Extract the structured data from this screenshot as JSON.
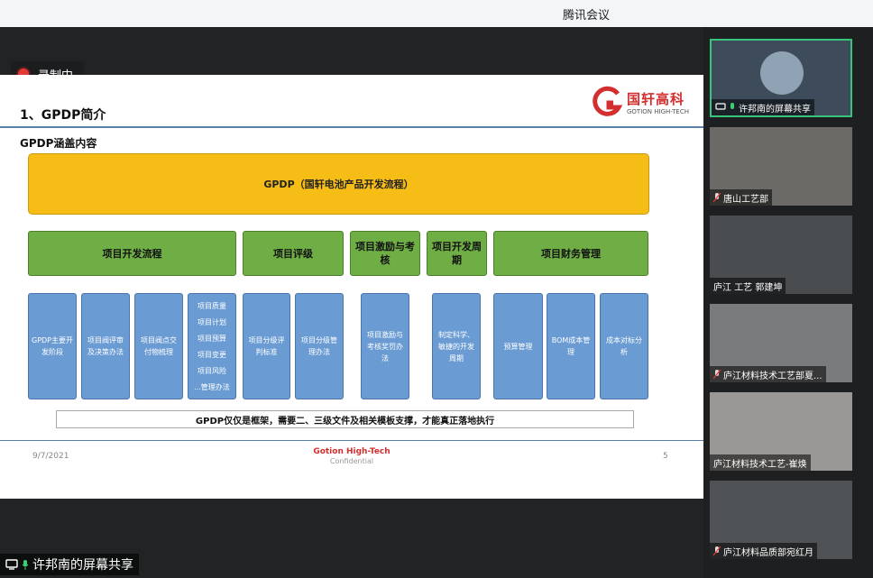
{
  "window": {
    "title": "腾讯会议"
  },
  "recording": {
    "label": "录制中"
  },
  "slide": {
    "logo_cn": "国轩高科",
    "logo_en": "GOTION HIGH-TECH",
    "heading": "1、GPDP简介",
    "subheading": "GPDP涵盖内容",
    "top_box": "GPDP（国轩电池产品开发流程）",
    "categories": [
      "项目开发流程",
      "项目评级",
      "项目激励与考核",
      "项目开发周期",
      "项目财务管理"
    ],
    "items": [
      "GPDP主要开发阶段",
      "项目阀评审及决策办法",
      "项目阀点交付物梳理",
      "项目分级评判标准",
      "项目分级管理办法",
      "项目激励与考核奖罚办法",
      "制定科学、敏捷的开发周期",
      "预算管理",
      "BOM成本管理",
      "成本对标分析"
    ],
    "list_item": [
      "项目质量",
      "项目计划",
      "项目预算",
      "项目变更",
      "项目风险",
      "...管理办法"
    ],
    "footer_note": "GPDP仅仅是框架，需要二、三级文件及相关模板支撑，才能真正落地执行",
    "date": "9/7/2021",
    "company": "Gotion High-Tech",
    "confidential": "Confidential",
    "page_number": "5"
  },
  "share_bar": {
    "label": "许邦南的屏幕共享"
  },
  "participants": [
    {
      "name": "许邦南的屏幕共享",
      "active": true
    },
    {
      "name": "唐山工艺部"
    },
    {
      "name": "庐江 工艺 郭建坤"
    },
    {
      "name": "庐江材料技术工艺部夏..."
    },
    {
      "name": "庐江材料技术工艺-崔焕"
    },
    {
      "name": "庐江材料品质部宛红月"
    }
  ]
}
